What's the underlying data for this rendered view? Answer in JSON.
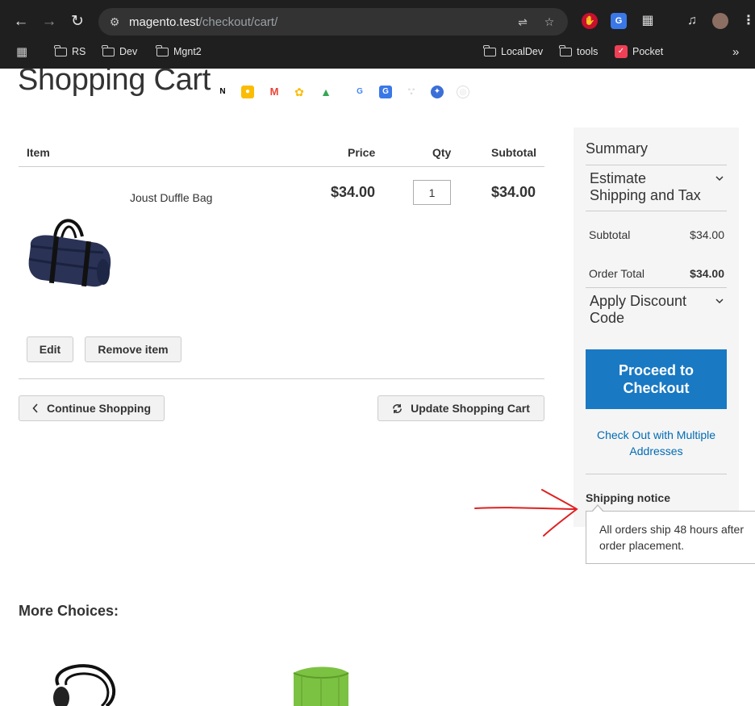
{
  "browser": {
    "url_host": "magento.test",
    "url_path": "/checkout/cart/",
    "bookmarks": [
      {
        "label": "RS"
      },
      {
        "label": "Dev"
      },
      {
        "label": "Mgnt2"
      },
      {
        "label": "LocalDev"
      },
      {
        "label": "tools"
      },
      {
        "label": "Pocket"
      }
    ],
    "more_bookmarks": "»"
  },
  "page": {
    "title": "Shopping Cart"
  },
  "cart": {
    "headers": {
      "item": "Item",
      "price": "Price",
      "qty": "Qty",
      "subtotal": "Subtotal"
    },
    "items": [
      {
        "name": "Joust Duffle Bag",
        "price": "$34.00",
        "qty": "1",
        "subtotal": "$34.00",
        "edit_label": "Edit",
        "remove_label": "Remove item"
      }
    ],
    "continue_label": "Continue Shopping",
    "update_label": "Update Shopping Cart"
  },
  "summary": {
    "title": "Summary",
    "estimate_label": "Estimate Shipping and Tax",
    "subtotal_label": "Subtotal",
    "subtotal_value": "$34.00",
    "order_total_label": "Order Total",
    "order_total_value": "$34.00",
    "discount_label": "Apply Discount Code",
    "checkout_label": "Proceed to Checkout",
    "multi_address_label": "Check Out with Multiple Addresses",
    "notice_title": "Shipping notice",
    "notice_text": "All orders ship 48 hours after order placement."
  },
  "more_choices": {
    "title": "More Choices:"
  },
  "colors": {
    "primary_button": "#1979c3",
    "link": "#006bb4",
    "annotation_arrow": "#e02020"
  }
}
